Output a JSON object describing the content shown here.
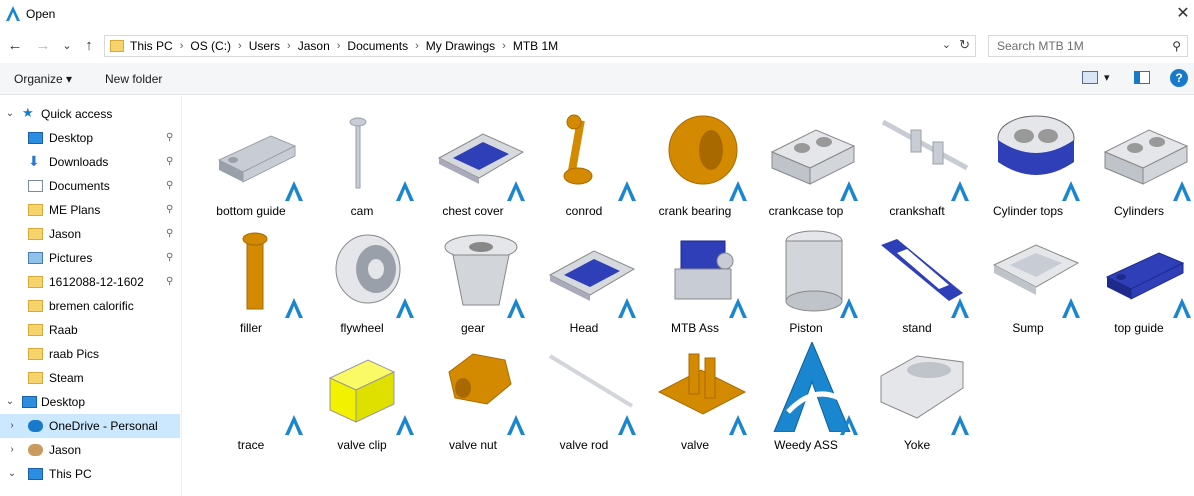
{
  "window": {
    "title": "Open",
    "close_glyph": "✕",
    "app_icon": "alibre-logo-icon"
  },
  "nav": {
    "back_glyph": "←",
    "forward_glyph": "→",
    "recent_glyph": "⌄",
    "up_glyph": "↑",
    "breadcrumbs": [
      "This PC",
      "OS (C:)",
      "Users",
      "Jason",
      "Documents",
      "My Drawings",
      "MTB 1M"
    ],
    "sep_glyph": "›",
    "dropdown_glyph": "⌄",
    "refresh_glyph": "↻",
    "search_placeholder": "Search MTB 1M",
    "search_glyph": "⚲"
  },
  "toolbar": {
    "organize_label": "Organize ▾",
    "new_folder_label": "New folder",
    "view_dd_glyph": "▾",
    "help_glyph": "?"
  },
  "sidebar": {
    "items": [
      {
        "label": "Quick access",
        "icon": "star-icon",
        "chev": "⌄",
        "indent": 0,
        "pinned": false
      },
      {
        "label": "Desktop",
        "icon": "desktop-icon",
        "chev": "",
        "indent": 1,
        "pinned": true
      },
      {
        "label": "Downloads",
        "icon": "download-icon",
        "chev": "",
        "indent": 1,
        "pinned": true
      },
      {
        "label": "Documents",
        "icon": "documents-icon",
        "chev": "",
        "indent": 1,
        "pinned": true
      },
      {
        "label": "ME Plans",
        "icon": "folder-icon",
        "chev": "",
        "indent": 1,
        "pinned": true
      },
      {
        "label": "Jason",
        "icon": "folder-icon",
        "chev": "",
        "indent": 1,
        "pinned": true
      },
      {
        "label": "Pictures",
        "icon": "pictures-icon",
        "chev": "",
        "indent": 1,
        "pinned": true
      },
      {
        "label": "1612088-12-1602",
        "icon": "folder-icon",
        "chev": "",
        "indent": 1,
        "pinned": true
      },
      {
        "label": "bremen calorific",
        "icon": "folder-icon",
        "chev": "",
        "indent": 1,
        "pinned": false
      },
      {
        "label": "Raab",
        "icon": "folder-icon",
        "chev": "",
        "indent": 1,
        "pinned": false
      },
      {
        "label": "raab Pics",
        "icon": "folder-icon",
        "chev": "",
        "indent": 1,
        "pinned": false
      },
      {
        "label": "Steam",
        "icon": "folder-icon",
        "chev": "",
        "indent": 1,
        "pinned": false
      },
      {
        "label": "Desktop",
        "icon": "desktop-icon",
        "chev": "⌄",
        "indent": 0,
        "pinned": false
      },
      {
        "label": "OneDrive - Personal",
        "icon": "cloud-icon",
        "chev": "›",
        "indent": 1,
        "pinned": false,
        "selected": true
      },
      {
        "label": "Jason",
        "icon": "user-icon",
        "chev": "›",
        "indent": 1,
        "pinned": false
      },
      {
        "label": "This PC",
        "icon": "pc-icon",
        "chev": "⌄",
        "indent": 1,
        "pinned": false
      }
    ],
    "pin_glyph": "📌"
  },
  "files": [
    {
      "name": "bottom guide",
      "shape": "slab",
      "color": "#c8ccd4"
    },
    {
      "name": "cam",
      "shape": "shaft",
      "color": "#c8ccd4"
    },
    {
      "name": "chest cover",
      "shape": "plate",
      "color": "#2f3fb8"
    },
    {
      "name": "conrod",
      "shape": "rod",
      "color": "#d48a00"
    },
    {
      "name": "crank bearing",
      "shape": "bush",
      "color": "#d48a00"
    },
    {
      "name": "crankcase top",
      "shape": "block",
      "color": "#c8ccd4"
    },
    {
      "name": "crankshaft",
      "shape": "crank",
      "color": "#c8ccd4"
    },
    {
      "name": "Cylinder tops",
      "shape": "cyltop",
      "color": "#2f3fb8"
    },
    {
      "name": "Cylinders",
      "shape": "block",
      "color": "#c8ccd4"
    },
    {
      "name": "filler",
      "shape": "pin",
      "color": "#d48a00"
    },
    {
      "name": "flywheel",
      "shape": "wheel",
      "color": "#c8ccd4"
    },
    {
      "name": "gear",
      "shape": "cone",
      "color": "#c8ccd4"
    },
    {
      "name": "Head",
      "shape": "plate",
      "color": "#2f3fb8"
    },
    {
      "name": "MTB Ass",
      "shape": "engine",
      "color": "#2f3fb8"
    },
    {
      "name": "Piston",
      "shape": "piston",
      "color": "#c8ccd4"
    },
    {
      "name": "stand",
      "shape": "stand",
      "color": "#2f3fb8"
    },
    {
      "name": "Sump",
      "shape": "tray",
      "color": "#c8ccd4"
    },
    {
      "name": "top guide",
      "shape": "slab",
      "color": "#2f3fb8"
    },
    {
      "name": "trace",
      "shape": "none",
      "color": "#ffffff"
    },
    {
      "name": "valve clip",
      "shape": "clip",
      "color": "#f2f200"
    },
    {
      "name": "valve nut",
      "shape": "nut",
      "color": "#d48a00"
    },
    {
      "name": "valve rod",
      "shape": "wire",
      "color": "#c8ccd4"
    },
    {
      "name": "valve",
      "shape": "valve",
      "color": "#d48a00"
    },
    {
      "name": "Weedy ASS",
      "shape": "logo",
      "color": "#1a86cf"
    },
    {
      "name": "Yoke",
      "shape": "yoke",
      "color": "#c8ccd4"
    }
  ],
  "colors": {
    "accent": "#1979ca",
    "selection": "#cce8ff",
    "logo": "#1a86cf"
  }
}
